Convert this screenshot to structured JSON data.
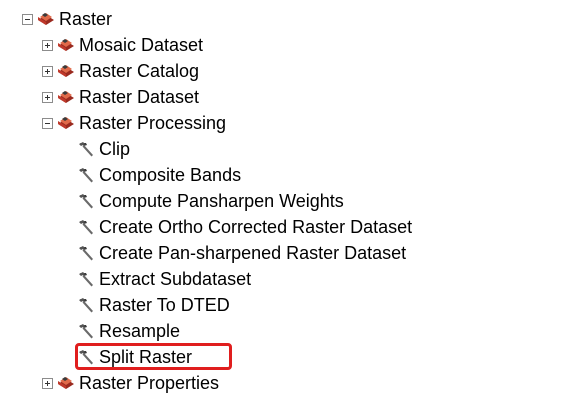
{
  "colors": {
    "highlight": "#e01e1e",
    "toolbox_red": "#c0392b",
    "expander_border": "#8c8c8c"
  },
  "tree": {
    "root": {
      "label": "Raster",
      "state": "expanded",
      "icon": "toolbox-icon"
    },
    "children": [
      {
        "label": "Mosaic Dataset",
        "state": "collapsed",
        "icon": "toolbox-icon"
      },
      {
        "label": "Raster Catalog",
        "state": "collapsed",
        "icon": "toolbox-icon"
      },
      {
        "label": "Raster Dataset",
        "state": "collapsed",
        "icon": "toolbox-icon"
      },
      {
        "label": "Raster Processing",
        "state": "expanded",
        "icon": "toolbox-icon"
      }
    ],
    "tools": [
      {
        "label": "Clip",
        "icon": "hammer-icon"
      },
      {
        "label": "Composite Bands",
        "icon": "hammer-icon"
      },
      {
        "label": "Compute Pansharpen Weights",
        "icon": "hammer-icon"
      },
      {
        "label": "Create Ortho Corrected Raster Dataset",
        "icon": "hammer-icon"
      },
      {
        "label": "Create Pan-sharpened Raster Dataset",
        "icon": "hammer-icon"
      },
      {
        "label": "Extract Subdataset",
        "icon": "hammer-icon"
      },
      {
        "label": "Raster To DTED",
        "icon": "hammer-icon"
      },
      {
        "label": "Resample",
        "icon": "hammer-icon"
      },
      {
        "label": "Split Raster",
        "icon": "hammer-icon",
        "highlighted": true
      }
    ],
    "after": [
      {
        "label": "Raster Properties",
        "state": "collapsed",
        "icon": "toolbox-icon"
      }
    ]
  }
}
